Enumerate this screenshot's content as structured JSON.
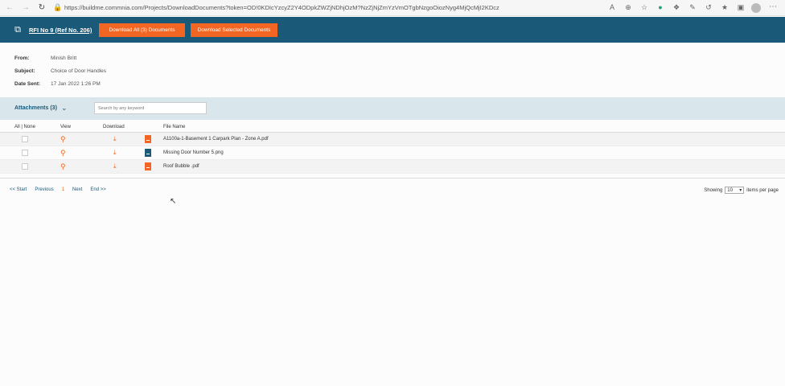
{
  "browser": {
    "url": "https://buildme.commnia.com/Projects/DownloadDocuments?token=OD!0KDIcYzcyZ2Y4ODpkZWZjNDhjOzM?NzZjNjZmYzVmOTgbNzgoOiozNyg4MjQcMjI2KDcz"
  },
  "header": {
    "title": "RFI No 9 (Ref No. 206)",
    "btn_download_all": "Download All (3) Documents",
    "btn_download_selected": "Download Selected Documents"
  },
  "info": {
    "from_label": "From:",
    "from_value": "Minish Britt",
    "subject_label": "Subject:",
    "subject_value": "Choice of Door Handles",
    "date_label": "Date Sent:",
    "date_value": "17 Jan 2022 1:26 PM"
  },
  "attachments": {
    "title": "Attachments (3)",
    "search_placeholder": "Search by any keyword"
  },
  "table": {
    "col_select": "All | None",
    "col_view": "View",
    "col_download": "Download",
    "col_filename": "File Name",
    "rows": [
      {
        "filename": "A1100a-1-Basement 1 Carpark Plan - Zone A.pdf",
        "type": "pdf"
      },
      {
        "filename": "Missing Door Number 5.png",
        "type": "png"
      },
      {
        "filename": "Roof Bubble .pdf",
        "type": "pdf"
      }
    ]
  },
  "pager": {
    "start": "<< Start",
    "previous": "Previous",
    "page": "1",
    "next": "Next",
    "end": "End >>",
    "showing_label": "Showing",
    "per_page_value": "10",
    "items_label": "items per page"
  },
  "colors": {
    "header_bg": "#1a5978",
    "accent": "#f26522",
    "attach_bar": "#d9e6ec"
  }
}
